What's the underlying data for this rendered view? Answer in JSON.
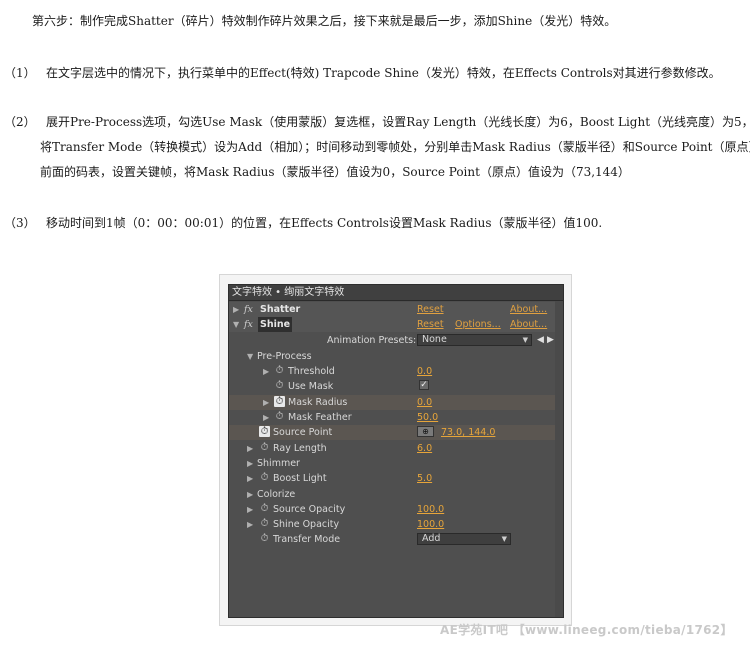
{
  "text": {
    "step_title": "第六步：制作完成Shatter（碎片）特效制作碎片效果之后，接下来就是最后一步，添加Shine（发光）特效。",
    "p1_num": "（1）",
    "p1": "在文字层选中的情况下，执行菜单中的Effect(特效) Trapcode Shine（发光）特效，在Effects Controls对其进行参数修改。",
    "p2_num": "（2）",
    "p2_l1": "展开Pre-Process选项，勾选Use Mask（使用蒙版）复选框，设置Ray Length（光线长度）为6，Boost Light（光线亮度）为5，",
    "p2_l2": "将Transfer Mode（转换模式）设为Add（相加）；时间移动到零帧处，分别单击Mask Radius（蒙版半径）和Source Point（原点）",
    "p2_l3": "前面的码表，设置关键帧，将Mask Radius（蒙版半径）值设为0，Source Point（原点）值设为（73,144）",
    "p3_num": "（3）",
    "p3": "移动时间到1帧（0：00：00:01）的位置，在Effects Controls设置Mask Radius（蒙版半径）值100."
  },
  "panel": {
    "title": "文字特效 • 绚丽文字特效",
    "fx_label": "fx",
    "shatter": {
      "name": "Shatter",
      "reset": "Reset",
      "about": "About..."
    },
    "shine": {
      "name": "Shine",
      "reset": "Reset",
      "options": "Options...",
      "about": "About..."
    },
    "animation_presets": {
      "label": "Animation Presets:",
      "value": "None"
    },
    "pre_process": "Pre-Process",
    "threshold": {
      "label": "Threshold",
      "value": "0.0"
    },
    "use_mask": {
      "label": "Use Mask",
      "checked": "✓"
    },
    "mask_radius": {
      "label": "Mask Radius",
      "value": "0.0"
    },
    "mask_feather": {
      "label": "Mask Feather",
      "value": "50.0"
    },
    "source_point": {
      "label": "Source Point",
      "value": "73.0, 144.0"
    },
    "ray_length": {
      "label": "Ray Length",
      "value": "6.0"
    },
    "shimmer": "Shimmer",
    "boost_light": {
      "label": "Boost Light",
      "value": "5.0"
    },
    "colorize": "Colorize",
    "source_opacity": {
      "label": "Source Opacity",
      "value": "100.0"
    },
    "shine_opacity": {
      "label": "Shine Opacity",
      "value": "100.0"
    },
    "transfer_mode": {
      "label": "Transfer Mode",
      "value": "Add"
    }
  },
  "watermark": "AE学苑IT吧  【www.lineeg.com/tieba/1762】",
  "colors": {
    "value_orange": "#e7a53a",
    "panel_bg": "#4f4f4f"
  }
}
